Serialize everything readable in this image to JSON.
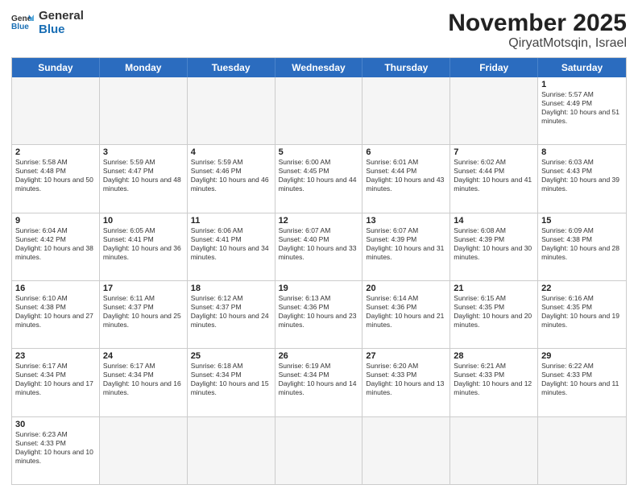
{
  "header": {
    "logo_general": "General",
    "logo_blue": "Blue",
    "month": "November 2025",
    "location": "QiryatMotsqin, Israel"
  },
  "weekdays": [
    "Sunday",
    "Monday",
    "Tuesday",
    "Wednesday",
    "Thursday",
    "Friday",
    "Saturday"
  ],
  "rows": [
    [
      {
        "day": "",
        "text": ""
      },
      {
        "day": "",
        "text": ""
      },
      {
        "day": "",
        "text": ""
      },
      {
        "day": "",
        "text": ""
      },
      {
        "day": "",
        "text": ""
      },
      {
        "day": "",
        "text": ""
      },
      {
        "day": "1",
        "text": "Sunrise: 5:57 AM\nSunset: 4:49 PM\nDaylight: 10 hours and 51 minutes."
      }
    ],
    [
      {
        "day": "2",
        "text": "Sunrise: 5:58 AM\nSunset: 4:48 PM\nDaylight: 10 hours and 50 minutes."
      },
      {
        "day": "3",
        "text": "Sunrise: 5:59 AM\nSunset: 4:47 PM\nDaylight: 10 hours and 48 minutes."
      },
      {
        "day": "4",
        "text": "Sunrise: 5:59 AM\nSunset: 4:46 PM\nDaylight: 10 hours and 46 minutes."
      },
      {
        "day": "5",
        "text": "Sunrise: 6:00 AM\nSunset: 4:45 PM\nDaylight: 10 hours and 44 minutes."
      },
      {
        "day": "6",
        "text": "Sunrise: 6:01 AM\nSunset: 4:44 PM\nDaylight: 10 hours and 43 minutes."
      },
      {
        "day": "7",
        "text": "Sunrise: 6:02 AM\nSunset: 4:44 PM\nDaylight: 10 hours and 41 minutes."
      },
      {
        "day": "8",
        "text": "Sunrise: 6:03 AM\nSunset: 4:43 PM\nDaylight: 10 hours and 39 minutes."
      }
    ],
    [
      {
        "day": "9",
        "text": "Sunrise: 6:04 AM\nSunset: 4:42 PM\nDaylight: 10 hours and 38 minutes."
      },
      {
        "day": "10",
        "text": "Sunrise: 6:05 AM\nSunset: 4:41 PM\nDaylight: 10 hours and 36 minutes."
      },
      {
        "day": "11",
        "text": "Sunrise: 6:06 AM\nSunset: 4:41 PM\nDaylight: 10 hours and 34 minutes."
      },
      {
        "day": "12",
        "text": "Sunrise: 6:07 AM\nSunset: 4:40 PM\nDaylight: 10 hours and 33 minutes."
      },
      {
        "day": "13",
        "text": "Sunrise: 6:07 AM\nSunset: 4:39 PM\nDaylight: 10 hours and 31 minutes."
      },
      {
        "day": "14",
        "text": "Sunrise: 6:08 AM\nSunset: 4:39 PM\nDaylight: 10 hours and 30 minutes."
      },
      {
        "day": "15",
        "text": "Sunrise: 6:09 AM\nSunset: 4:38 PM\nDaylight: 10 hours and 28 minutes."
      }
    ],
    [
      {
        "day": "16",
        "text": "Sunrise: 6:10 AM\nSunset: 4:38 PM\nDaylight: 10 hours and 27 minutes."
      },
      {
        "day": "17",
        "text": "Sunrise: 6:11 AM\nSunset: 4:37 PM\nDaylight: 10 hours and 25 minutes."
      },
      {
        "day": "18",
        "text": "Sunrise: 6:12 AM\nSunset: 4:37 PM\nDaylight: 10 hours and 24 minutes."
      },
      {
        "day": "19",
        "text": "Sunrise: 6:13 AM\nSunset: 4:36 PM\nDaylight: 10 hours and 23 minutes."
      },
      {
        "day": "20",
        "text": "Sunrise: 6:14 AM\nSunset: 4:36 PM\nDaylight: 10 hours and 21 minutes."
      },
      {
        "day": "21",
        "text": "Sunrise: 6:15 AM\nSunset: 4:35 PM\nDaylight: 10 hours and 20 minutes."
      },
      {
        "day": "22",
        "text": "Sunrise: 6:16 AM\nSunset: 4:35 PM\nDaylight: 10 hours and 19 minutes."
      }
    ],
    [
      {
        "day": "23",
        "text": "Sunrise: 6:17 AM\nSunset: 4:34 PM\nDaylight: 10 hours and 17 minutes."
      },
      {
        "day": "24",
        "text": "Sunrise: 6:17 AM\nSunset: 4:34 PM\nDaylight: 10 hours and 16 minutes."
      },
      {
        "day": "25",
        "text": "Sunrise: 6:18 AM\nSunset: 4:34 PM\nDaylight: 10 hours and 15 minutes."
      },
      {
        "day": "26",
        "text": "Sunrise: 6:19 AM\nSunset: 4:34 PM\nDaylight: 10 hours and 14 minutes."
      },
      {
        "day": "27",
        "text": "Sunrise: 6:20 AM\nSunset: 4:33 PM\nDaylight: 10 hours and 13 minutes."
      },
      {
        "day": "28",
        "text": "Sunrise: 6:21 AM\nSunset: 4:33 PM\nDaylight: 10 hours and 12 minutes."
      },
      {
        "day": "29",
        "text": "Sunrise: 6:22 AM\nSunset: 4:33 PM\nDaylight: 10 hours and 11 minutes."
      }
    ],
    [
      {
        "day": "30",
        "text": "Sunrise: 6:23 AM\nSunset: 4:33 PM\nDaylight: 10 hours and 10 minutes."
      },
      {
        "day": "",
        "text": ""
      },
      {
        "day": "",
        "text": ""
      },
      {
        "day": "",
        "text": ""
      },
      {
        "day": "",
        "text": ""
      },
      {
        "day": "",
        "text": ""
      },
      {
        "day": "",
        "text": ""
      }
    ]
  ]
}
